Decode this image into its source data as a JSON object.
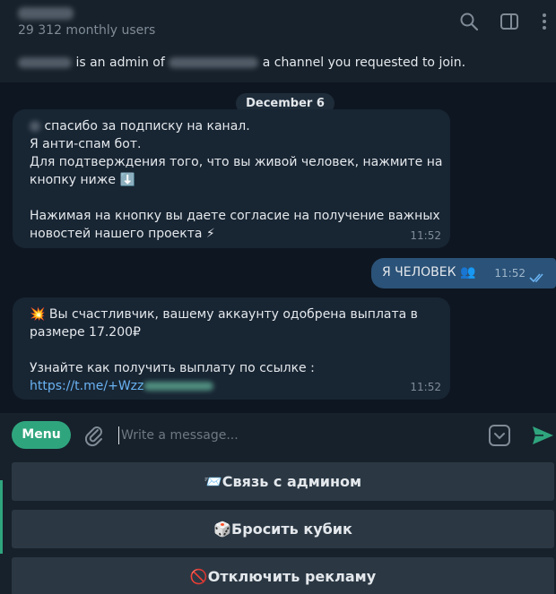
{
  "header": {
    "subtitle": "29 312 monthly users"
  },
  "banner": {
    "text_admin": "is an admin of",
    "text_channel": "a channel you requested to join."
  },
  "chat": {
    "date": "December 6",
    "messages": [
      {
        "direction": "in",
        "lines": [
          "спасибо за подписку на канал.",
          "Я анти-спам бот.",
          "Для подтверждения того, что вы живой человек, нажмите на",
          "кнопку ниже ⬇️",
          "",
          "Нажимая на кнопку вы даете согласие на получение важных",
          "новостей нашего проекта ⚡"
        ],
        "time": "11:52"
      },
      {
        "direction": "out",
        "text": "Я ЧЕЛОВЕК 👥",
        "time": "11:52"
      },
      {
        "direction": "in",
        "lines": [
          "💥 Вы счастливчик, вашему аккаунту одобрена выплата в",
          "размере 17.200₽",
          "",
          "Узнайте как получить выплату по ссылке :"
        ],
        "link": "https://t.me/+Wzz",
        "time": "11:52"
      }
    ]
  },
  "compose": {
    "menu_label": "Menu",
    "placeholder": "Write a message..."
  },
  "keyboard": {
    "buttons": [
      "📨Связь с админом",
      "🎲Бросить кубик",
      "🚫Отключить рекламу"
    ]
  },
  "colors": {
    "accent": "#2fa57e",
    "link": "#6ab3f3",
    "outgoing_bubble": "#2b5278",
    "incoming_bubble": "#182533"
  }
}
